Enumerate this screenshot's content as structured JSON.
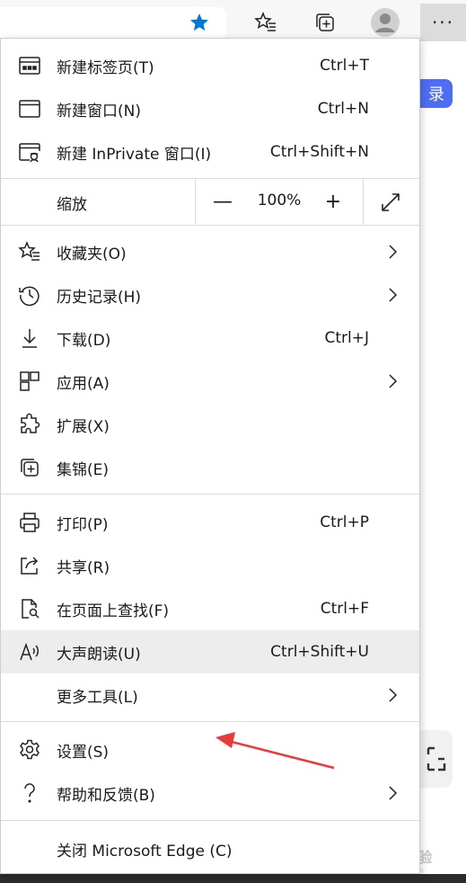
{
  "toolbar": {
    "more_label": "···"
  },
  "page": {
    "login_char": "录",
    "accent_color": "#4e6ef2"
  },
  "menu": {
    "group1": [
      {
        "icon": "new-tab-icon",
        "label": "新建标签页(T)",
        "shortcut": "Ctrl+T"
      },
      {
        "icon": "new-window-icon",
        "label": "新建窗口(N)",
        "shortcut": "Ctrl+N"
      },
      {
        "icon": "inprivate-window-icon",
        "label": "新建 InPrivate 窗口(I)",
        "shortcut": "Ctrl+Shift+N"
      }
    ],
    "zoom": {
      "label": "缩放",
      "minus": "—",
      "value": "100%",
      "plus": "+"
    },
    "group2": [
      {
        "icon": "favorites-icon",
        "label": "收藏夹(O)",
        "submenu": true
      },
      {
        "icon": "history-icon",
        "label": "历史记录(H)",
        "submenu": true
      },
      {
        "icon": "download-icon",
        "label": "下载(D)",
        "shortcut": "Ctrl+J"
      },
      {
        "icon": "apps-icon",
        "label": "应用(A)",
        "submenu": true
      },
      {
        "icon": "extensions-icon",
        "label": "扩展(X)"
      },
      {
        "icon": "collections-icon",
        "label": "集锦(E)"
      }
    ],
    "group3": [
      {
        "icon": "print-icon",
        "label": "打印(P)",
        "shortcut": "Ctrl+P"
      },
      {
        "icon": "share-icon",
        "label": "共享(R)"
      },
      {
        "icon": "find-on-page-icon",
        "label": "在页面上查找(F)",
        "shortcut": "Ctrl+F"
      },
      {
        "icon": "read-aloud-icon",
        "label": "大声朗读(U)",
        "shortcut": "Ctrl+Shift+U",
        "highlighted": true
      },
      {
        "icon": "",
        "label": "更多工具(L)",
        "submenu": true
      }
    ],
    "group4": [
      {
        "icon": "settings-icon",
        "label": "设置(S)"
      },
      {
        "icon": "help-icon",
        "label": "帮助和反馈(B)",
        "submenu": true
      }
    ],
    "close": {
      "label": "关闭 Microsoft Edge (C)"
    }
  },
  "watermark": {
    "text": "Baidu经验",
    "sub": "jingyan.baidu.com"
  },
  "colors": {
    "star": "#0078d4",
    "arrow": "#e83a3a",
    "highlight": "#ededed"
  }
}
